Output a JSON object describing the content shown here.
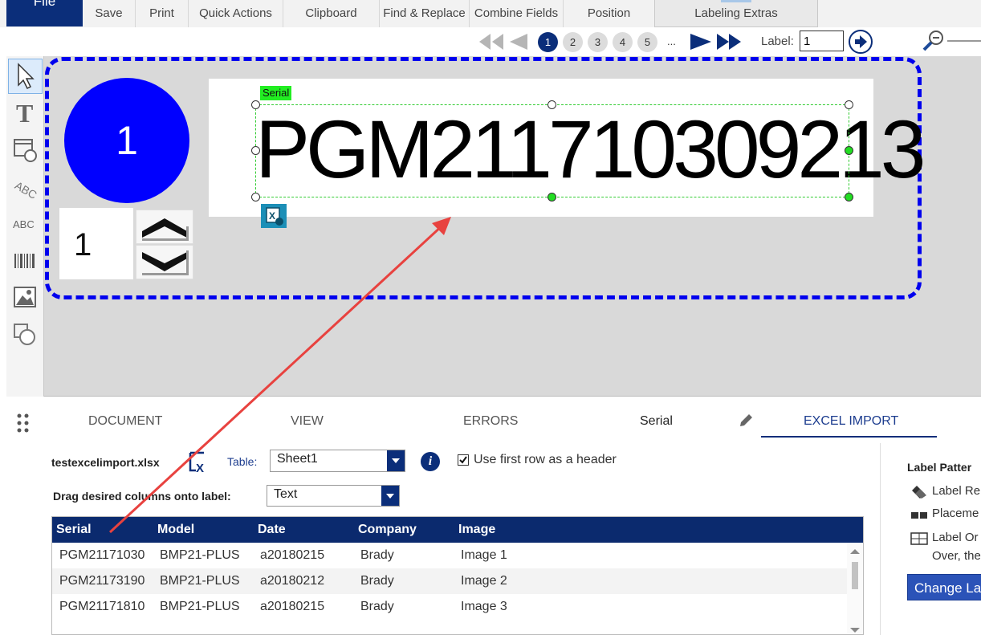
{
  "ribbon": {
    "file_label": "File",
    "items": [
      "Save",
      "Print",
      "Quick Actions",
      "Clipboard",
      "Find & Replace",
      "Combine Fields",
      "Position"
    ],
    "extras_label": "Labeling Extras"
  },
  "nav": {
    "pages": [
      "1",
      "2",
      "3",
      "4",
      "5"
    ],
    "ellipsis": "...",
    "label_text": "Label:",
    "label_value": "1"
  },
  "canvas": {
    "circle_number": "1",
    "counter_value": "1",
    "field_tag": "Serial",
    "serial_text": "PGM211710309213"
  },
  "bottom_tabs": [
    "DOCUMENT",
    "VIEW",
    "ERRORS",
    "Serial",
    "EXCEL IMPORT"
  ],
  "excel": {
    "filename": "testexcelimport.xlsx",
    "table_label": "Table:",
    "table_value": "Sheet1",
    "use_header_label": "Use first row as a header",
    "drag_label": "Drag desired columns onto label:",
    "drag_value": "Text",
    "columns": [
      "Serial",
      "Model",
      "Date",
      "Company",
      "Image"
    ],
    "rows": [
      [
        "PGM21171030",
        "BMP21-PLUS",
        "a20180215",
        "Brady",
        "Image 1"
      ],
      [
        "PGM21173190",
        "BMP21-PLUS",
        "a20180212",
        "Brady",
        "Image 2"
      ],
      [
        "PGM21171810",
        "BMP21-PLUS",
        "a20180215",
        "Brady",
        "Image 3"
      ]
    ]
  },
  "right_panel": {
    "title": "Label Patter",
    "items": [
      "Label Re",
      "Placeme",
      "Label Or"
    ],
    "item_extra": "Over, the",
    "button": "Change Lab"
  },
  "colors": {
    "brand_navy": "#0b2e7a",
    "label_outline": "#0000ee",
    "circle": "#0000ff",
    "field_tag": "#22ee22",
    "annotation_arrow": "#e8423f"
  }
}
